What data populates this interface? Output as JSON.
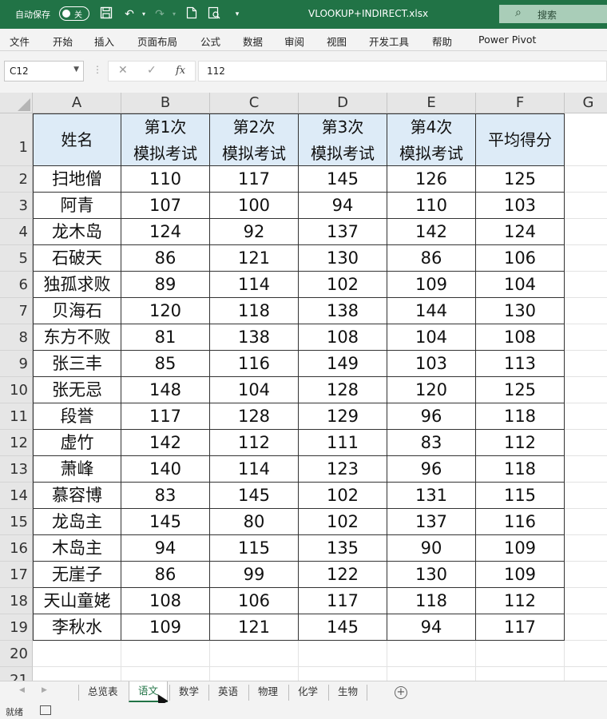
{
  "titlebar": {
    "autosave_label": "自动保存",
    "autosave_state": "关",
    "document_title": "VLOOKUP+INDIRECT.xlsx",
    "search_placeholder": "搜索",
    "icons": [
      "save-icon",
      "undo-icon",
      "redo-icon",
      "new-doc-icon",
      "print-preview-icon",
      "customize-qat-icon"
    ]
  },
  "menu": [
    "文件",
    "开始",
    "插入",
    "页面布局",
    "公式",
    "数据",
    "审阅",
    "视图",
    "开发工具",
    "帮助",
    "Power Pivot"
  ],
  "formula_bar": {
    "name_box": "C12",
    "fx_label": "fx",
    "content": "112"
  },
  "sheet": {
    "columns": [
      "A",
      "B",
      "C",
      "D",
      "E",
      "F",
      "G"
    ],
    "row_numbers": [
      "1",
      "2",
      "3",
      "4",
      "5",
      "6",
      "7",
      "8",
      "9",
      "10",
      "11",
      "12",
      "13",
      "14",
      "15",
      "16",
      "17",
      "18",
      "19",
      "20",
      "21"
    ],
    "header": [
      [
        "姓名"
      ],
      [
        "第1次",
        "模拟考试"
      ],
      [
        "第2次",
        "模拟考试"
      ],
      [
        "第3次",
        "模拟考试"
      ],
      [
        "第4次",
        "模拟考试"
      ],
      [
        "平均得分"
      ]
    ],
    "rows": [
      [
        "扫地僧",
        "110",
        "117",
        "145",
        "126",
        "125"
      ],
      [
        "阿青",
        "107",
        "100",
        "94",
        "110",
        "103"
      ],
      [
        "龙木岛",
        "124",
        "92",
        "137",
        "142",
        "124"
      ],
      [
        "石破天",
        "86",
        "121",
        "130",
        "86",
        "106"
      ],
      [
        "独孤求败",
        "89",
        "114",
        "102",
        "109",
        "104"
      ],
      [
        "贝海石",
        "120",
        "118",
        "138",
        "144",
        "130"
      ],
      [
        "东方不败",
        "81",
        "138",
        "108",
        "104",
        "108"
      ],
      [
        "张三丰",
        "85",
        "116",
        "149",
        "103",
        "113"
      ],
      [
        "张无忌",
        "148",
        "104",
        "128",
        "120",
        "125"
      ],
      [
        "段誉",
        "117",
        "128",
        "129",
        "96",
        "118"
      ],
      [
        "虚竹",
        "142",
        "112",
        "111",
        "83",
        "112"
      ],
      [
        "萧峰",
        "140",
        "114",
        "123",
        "96",
        "118"
      ],
      [
        "慕容博",
        "83",
        "145",
        "102",
        "131",
        "115"
      ],
      [
        "龙岛主",
        "145",
        "80",
        "102",
        "137",
        "116"
      ],
      [
        "木岛主",
        "94",
        "115",
        "135",
        "90",
        "109"
      ],
      [
        "无崖子",
        "86",
        "99",
        "122",
        "130",
        "109"
      ],
      [
        "天山童姥",
        "108",
        "106",
        "117",
        "118",
        "112"
      ],
      [
        "李秋水",
        "109",
        "121",
        "145",
        "94",
        "117"
      ]
    ]
  },
  "tabs": [
    "总览表",
    "语文",
    "数学",
    "英语",
    "物理",
    "化学",
    "生物"
  ],
  "active_tab": "语文",
  "status": "就绪",
  "colors": {
    "excel_green": "#217346",
    "header_fill": "#ddebf7"
  }
}
